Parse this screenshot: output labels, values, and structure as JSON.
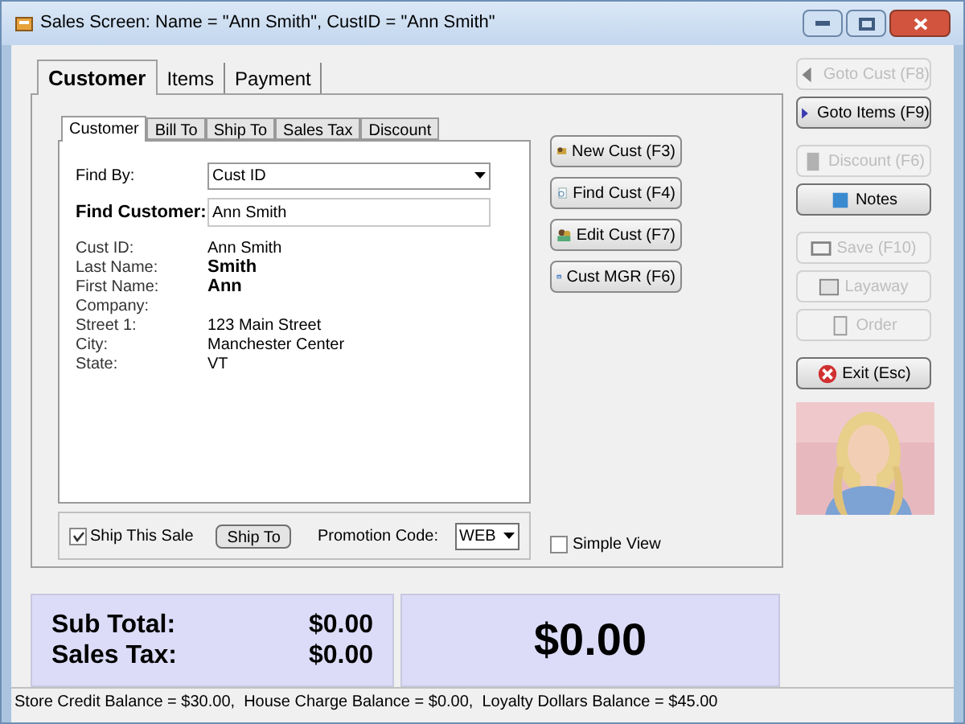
{
  "window": {
    "title": "Sales Screen: Name = \"Ann Smith\", CustID = \"Ann Smith\""
  },
  "main_tabs": [
    {
      "label": "Customer",
      "selected": true
    },
    {
      "label": "Items",
      "selected": false
    },
    {
      "label": "Payment",
      "selected": false
    }
  ],
  "sub_tabs": [
    {
      "label": "Customer",
      "selected": true
    },
    {
      "label": "Bill To",
      "selected": false
    },
    {
      "label": "Ship To",
      "selected": false
    },
    {
      "label": "Sales Tax",
      "selected": false
    },
    {
      "label": "Discount",
      "selected": false
    }
  ],
  "find_by": {
    "label": "Find By:",
    "value": "Cust ID"
  },
  "find_customer": {
    "label": "Find Customer:",
    "value": "Ann Smith"
  },
  "details": [
    {
      "label": "Cust ID:",
      "value": "Ann Smith",
      "bold": false
    },
    {
      "label": "Last Name:",
      "value": "Smith",
      "bold": true
    },
    {
      "label": "First Name:",
      "value": "Ann",
      "bold": true
    },
    {
      "label": "Company:"
    },
    {
      "label": "Street 1:",
      "value": "123 Main Street",
      "bold": false
    },
    {
      "label": "City:",
      "value": "Manchester Center",
      "bold": false
    },
    {
      "label": "State:",
      "value": "VT",
      "bold": false
    }
  ],
  "ship_this_sale": {
    "label": "Ship This Sale",
    "checked": true
  },
  "ship_to_button": "Ship To",
  "promotion_code": {
    "label": "Promotion Code:",
    "value": "WEB"
  },
  "simple_view": {
    "label": "Simple View",
    "checked": false
  },
  "customer_buttons": [
    "New Cust (F3)",
    "Find Cust (F4)",
    "Edit Cust (F7)",
    "Cust MGR (F6)"
  ],
  "side_buttons": [
    [
      {
        "label": "Goto Cust (F8)",
        "disabled": true
      },
      {
        "label": "Goto Items (F9)",
        "disabled": false
      }
    ],
    [
      {
        "label": "Discount (F6)",
        "disabled": true
      },
      {
        "label": "Notes",
        "disabled": false
      }
    ],
    [
      {
        "label": "Save (F10)",
        "disabled": true
      },
      {
        "label": "Layaway",
        "disabled": true
      },
      {
        "label": "Order",
        "disabled": true
      }
    ],
    [
      {
        "label": "Exit (Esc)",
        "disabled": false
      }
    ]
  ],
  "totals": {
    "sub_total_label": "Sub Total:",
    "sub_total": "$0.00",
    "sales_tax_label": "Sales Tax:",
    "sales_tax": "$0.00",
    "grand_total": "$0.00"
  },
  "status_bar": "Store Credit Balance = $30.00,  House Charge Balance = $0.00,  Loyalty Dollars Balance = $45.00"
}
